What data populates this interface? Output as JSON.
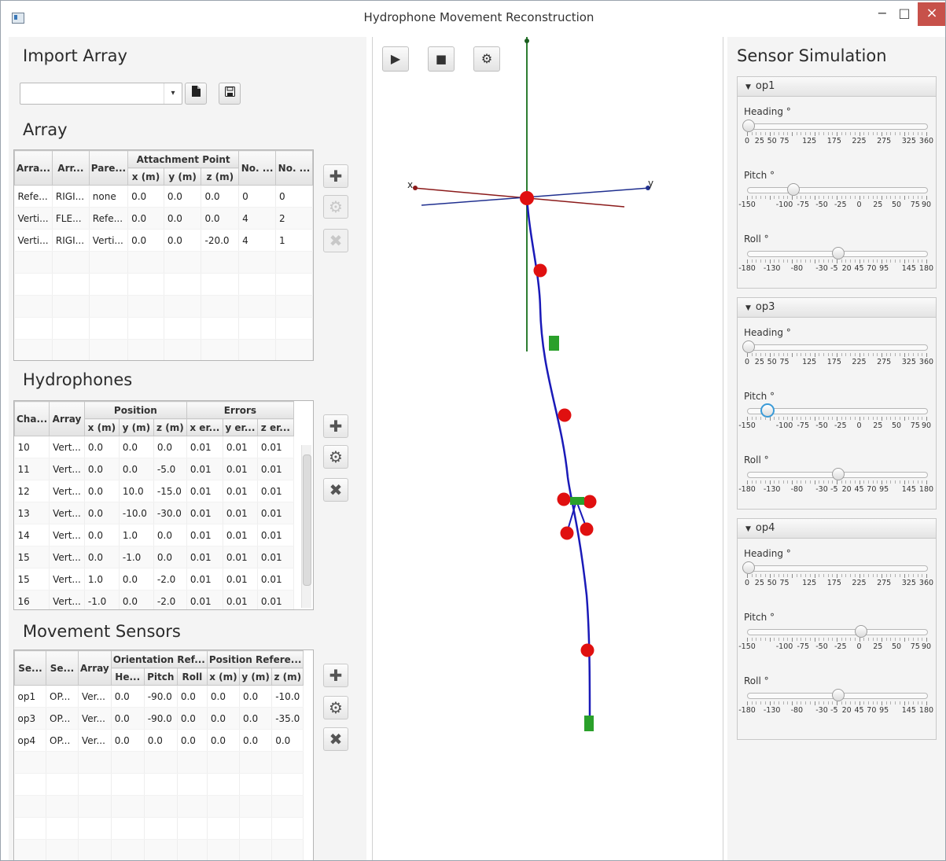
{
  "window": {
    "title": "Hydrophone Movement Reconstruction",
    "minimize_icon": "−",
    "maximize_icon": "□",
    "close_icon": "×"
  },
  "import_array": {
    "heading": "Import Array",
    "combo_value": "",
    "combo_arrow": "▾",
    "file_icon": "▮",
    "save_icon": "🖫"
  },
  "array": {
    "heading": "Array",
    "group_attachment": "Attachment Point",
    "headers": [
      "Arra...",
      "Arr...",
      "Pare...",
      "x (m)",
      "y (m)",
      "z (m)",
      "No. ...",
      "No. ..."
    ],
    "rows": [
      [
        "Refe...",
        "RIGI...",
        "none",
        "0.0",
        "0.0",
        "0.0",
        "0",
        "0"
      ],
      [
        "Verti...",
        "FLE...",
        "Refe...",
        "0.0",
        "0.0",
        "0.0",
        "4",
        "2"
      ],
      [
        "Verti...",
        "RIGI...",
        "Verti...",
        "0.0",
        "0.0",
        "-20.0",
        "4",
        "1"
      ]
    ]
  },
  "hydrophones": {
    "heading": "Hydrophones",
    "group_position": "Position",
    "group_errors": "Errors",
    "headers": [
      "Cha...",
      "Array",
      "x (m)",
      "y (m)",
      "z (m)",
      "x er...",
      "y er...",
      "z er..."
    ],
    "rows": [
      [
        "10",
        "Vert...",
        "0.0",
        "0.0",
        "0.0",
        "0.01",
        "0.01",
        "0.01"
      ],
      [
        "11",
        "Vert...",
        "0.0",
        "0.0",
        "-5.0",
        "0.01",
        "0.01",
        "0.01"
      ],
      [
        "12",
        "Vert...",
        "0.0",
        "10.0",
        "-15.0",
        "0.01",
        "0.01",
        "0.01"
      ],
      [
        "13",
        "Vert...",
        "0.0",
        "-10.0",
        "-30.0",
        "0.01",
        "0.01",
        "0.01"
      ],
      [
        "14",
        "Vert...",
        "0.0",
        "1.0",
        "0.0",
        "0.01",
        "0.01",
        "0.01"
      ],
      [
        "15",
        "Vert...",
        "0.0",
        "-1.0",
        "0.0",
        "0.01",
        "0.01",
        "0.01"
      ],
      [
        "15",
        "Vert...",
        "1.0",
        "0.0",
        "-2.0",
        "0.01",
        "0.01",
        "0.01"
      ],
      [
        "16",
        "Vert...",
        "-1.0",
        "0.0",
        "-2.0",
        "0.01",
        "0.01",
        "0.01"
      ]
    ]
  },
  "movement_sensors": {
    "heading": "Movement Sensors",
    "group_orientation": "Orientation Ref...",
    "group_position": "Position Refere...",
    "headers": [
      "Se...",
      "Se...",
      "Array",
      "He...",
      "Pitch",
      "Roll",
      "x (m)",
      "y (m)",
      "z (m)"
    ],
    "rows": [
      [
        "op1",
        "OP...",
        "Ver...",
        "0.0",
        "-90.0",
        "0.0",
        "0.0",
        "0.0",
        "-10.0"
      ],
      [
        "op3",
        "OP...",
        "Ver...",
        "0.0",
        "-90.0",
        "0.0",
        "0.0",
        "0.0",
        "-35.0"
      ],
      [
        "op4",
        "OP...",
        "Ver...",
        "0.0",
        "0.0",
        "0.0",
        "0.0",
        "0.0",
        "0.0"
      ]
    ]
  },
  "side_buttons": {
    "add_icon": "✚",
    "settings_icon": "⚙",
    "delete_icon": "✖"
  },
  "toolbar": {
    "play_icon": "▶",
    "stop_icon": "■",
    "settings_icon": "⚙"
  },
  "view3d": {
    "axis_x_label": "x",
    "axis_y_label": "y",
    "colors": {
      "x_axis": "#8b1a1a",
      "y_axis": "#1f2f8f",
      "z_axis": "#2e7d32",
      "cable": "#1a1ab8",
      "hydrophone": "#e01010",
      "sensor": "#2aa02a"
    }
  },
  "sensor_simulation": {
    "heading": "Sensor Simulation",
    "expanded_icon": "▼",
    "heading_label": "Heading °",
    "pitch_label": "Pitch °",
    "roll_label": "Roll °",
    "heading_ticks": [
      "0",
      "25",
      "50",
      "75",
      "125",
      "175",
      "225",
      "275",
      "325",
      "360"
    ],
    "pitch_ticks": [
      "-150",
      "-100",
      "-75",
      "-50",
      "-25",
      "0",
      "25",
      "50",
      "75",
      "90"
    ],
    "roll_ticks": [
      "-180",
      "-130",
      "-80",
      "-30",
      "-5",
      "20",
      "45",
      "70",
      "95",
      "145",
      "180"
    ],
    "panels": [
      {
        "name": "op1",
        "heading": 0,
        "pitch": -90,
        "roll": 0
      },
      {
        "name": "op3",
        "heading": 0,
        "pitch": -126,
        "roll": 0
      },
      {
        "name": "op4",
        "heading": 0,
        "pitch": 0,
        "roll": 0
      }
    ]
  }
}
